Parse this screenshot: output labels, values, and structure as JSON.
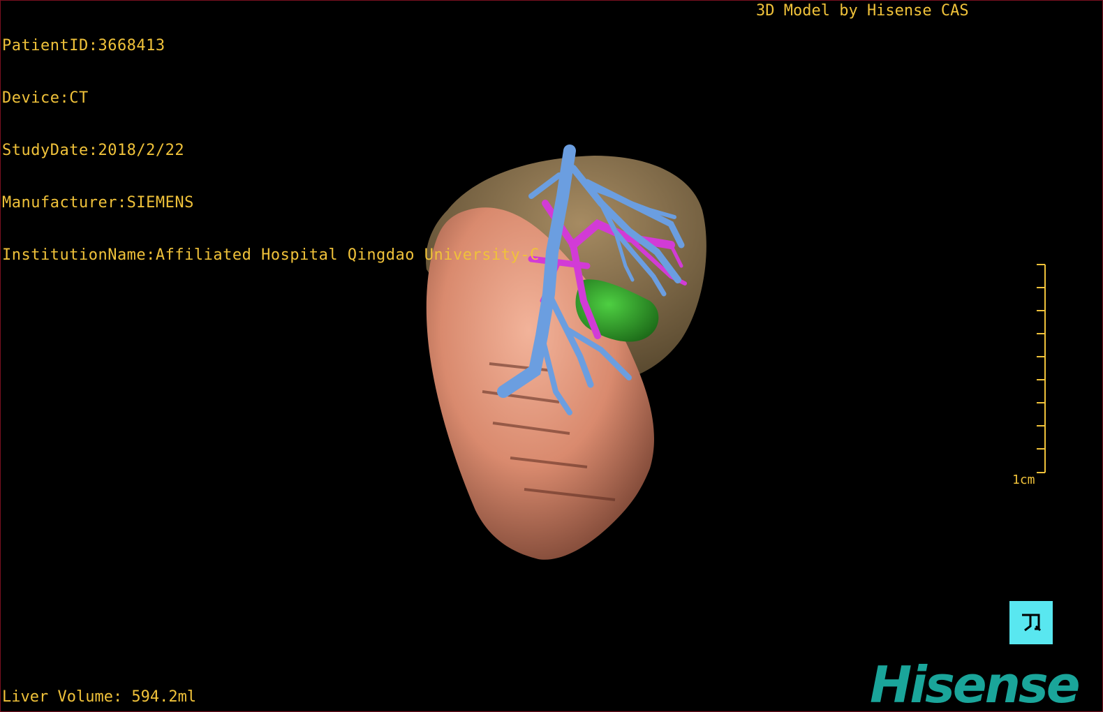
{
  "header": {
    "patient_id": "PatientID:3668413",
    "device": "Device:CT",
    "study_date": "StudyDate:2018/2/22",
    "manufacturer": "Manufacturer:SIEMENS",
    "institution": "InstitutionName:Affiliated Hospital Qingdao University-C"
  },
  "credit": "3D Model by Hisense CAS",
  "liver_volume": "Liver Volume: 594.2ml",
  "scale_bar": {
    "label": "1cm"
  },
  "orientation_marker": {
    "icon": "orientation-cube-icon"
  },
  "logo": {
    "text": "Hisense"
  },
  "colors": {
    "text": "#f0c23a",
    "liver_front": "#d98a6e",
    "liver_back": "#8a7350",
    "portal_vein": "#6b9ee0",
    "hepatic_artery": "#d23bd6",
    "lesion": "#2f9a2a",
    "logo": "#1aa59a",
    "orientation_marker": "#59e7f0"
  }
}
